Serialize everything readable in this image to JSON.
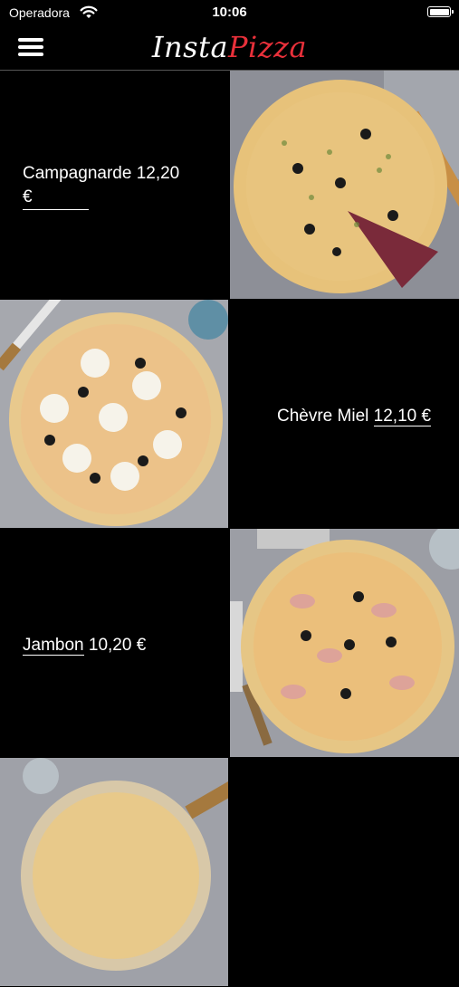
{
  "status_bar": {
    "carrier": "Operadora",
    "time": "10:06"
  },
  "header": {
    "logo_insta": "Insta",
    "logo_pizza": "Pizza",
    "brand_red": "#e8303a"
  },
  "products": [
    {
      "name": "Campagnarde",
      "price": "12,20",
      "currency": "€"
    },
    {
      "name": "Chèvre Miel",
      "price": "12,10",
      "currency": "€"
    },
    {
      "name": "Jambon",
      "price": "10,20",
      "currency": "€"
    }
  ],
  "icons": {
    "menu": "hamburger-menu-icon",
    "wifi": "wifi-icon",
    "battery": "battery-icon"
  }
}
